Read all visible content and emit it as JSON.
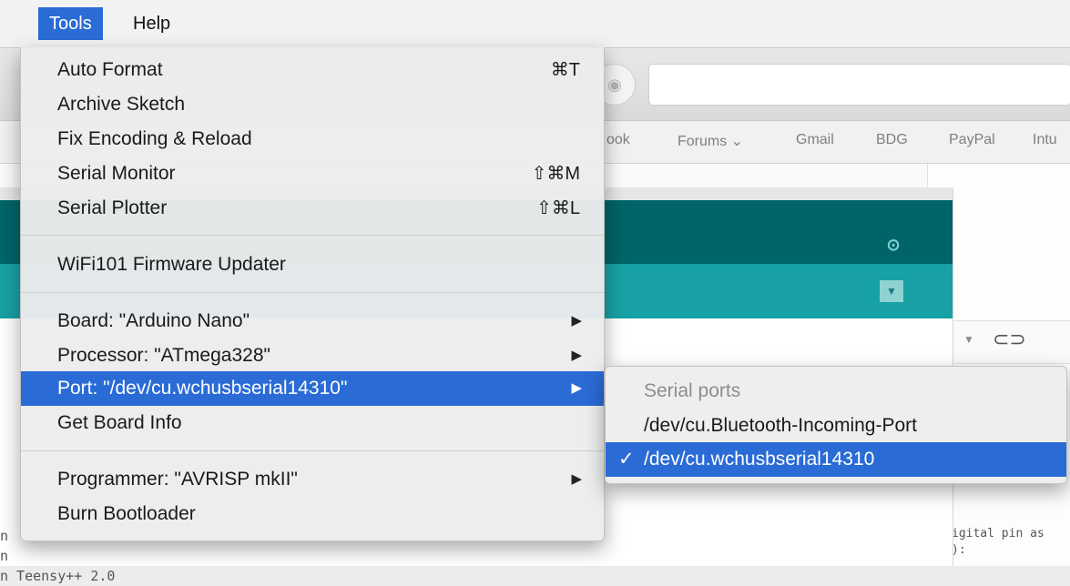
{
  "menubar": {
    "items": [
      {
        "label": "Tools",
        "active": true
      },
      {
        "label": "Help",
        "active": false
      }
    ]
  },
  "browser": {
    "bookmarks": [
      "ook",
      "Forums ⌄",
      "Gmail",
      "BDG",
      "PayPal",
      "Intu"
    ]
  },
  "tools_menu": {
    "items": [
      {
        "label": "Auto Format",
        "shortcut": "⌘T"
      },
      {
        "label": "Archive Sketch"
      },
      {
        "label": "Fix Encoding & Reload"
      },
      {
        "label": "Serial Monitor",
        "shortcut": "⇧⌘M"
      },
      {
        "label": "Serial Plotter",
        "shortcut": "⇧⌘L"
      },
      {
        "label": "WiFi101 Firmware Updater"
      },
      {
        "label": "Board: \"Arduino Nano\"",
        "submenu": true
      },
      {
        "label": "Processor: \"ATmega328\"",
        "submenu": true
      },
      {
        "label": "Port: \"/dev/cu.wchusbserial14310\"",
        "submenu": true,
        "highlighted": true
      },
      {
        "label": "Get Board Info"
      },
      {
        "label": "Programmer: \"AVRISP mkII\"",
        "submenu": true
      },
      {
        "label": "Burn Bootloader"
      }
    ],
    "submenu_arrow": "▶"
  },
  "port_submenu": {
    "header": "Serial ports",
    "items": [
      {
        "label": "/dev/cu.Bluetooth-Incoming-Port",
        "selected": false
      },
      {
        "label": "/dev/cu.wchusbserial14310",
        "selected": true
      }
    ],
    "check_mark": "✓"
  },
  "ide": {
    "code_lines": [
      "n",
      "n",
      "n Teensy++ 2.0"
    ],
    "right_code_lines": [
      "igital pin as",
      "):"
    ]
  },
  "colors": {
    "highlight": "#2a6bd6",
    "ide_toolbar": "#006468",
    "ide_tabbar": "#17a1a5"
  }
}
